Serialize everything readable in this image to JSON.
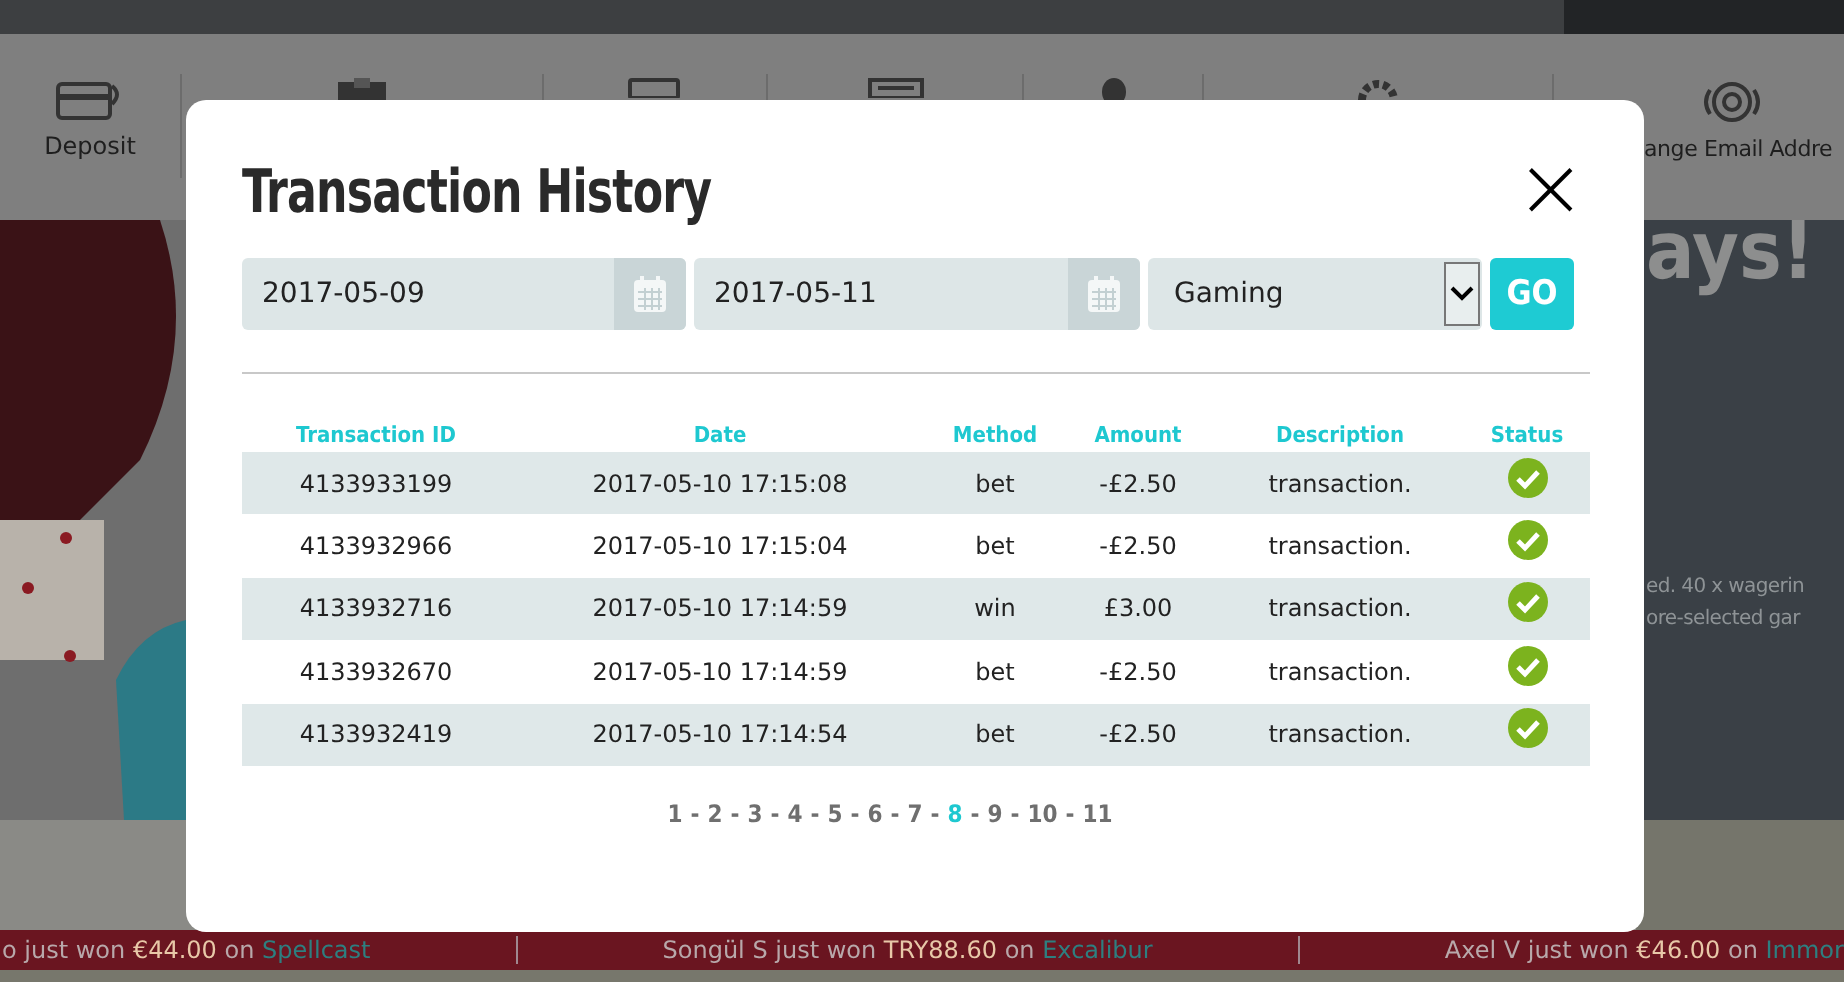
{
  "nav": {
    "first_label": "Deposit",
    "last_label": "ange Email Addre"
  },
  "banner": {
    "heading": "ays!",
    "lines": [
      "ed. 40 x wagerin",
      "ore-selected gar"
    ]
  },
  "dialog": {
    "title": "Transaction History",
    "close": "×",
    "filters": {
      "date_from": "2017-05-09",
      "date_to": "2017-05-11",
      "category": "Gaming",
      "go": "GO"
    },
    "table": {
      "columns": [
        "Transaction ID",
        "Date",
        "Method",
        "Amount",
        "Description",
        "Status"
      ],
      "rows": [
        {
          "id": "4133933199",
          "date": "2017-05-10 17:15:08",
          "method": "bet",
          "amount": "-£2.50",
          "description": "transaction.",
          "succeeded": true
        },
        {
          "id": "4133932966",
          "date": "2017-05-10 17:15:04",
          "method": "bet",
          "amount": "-£2.50",
          "description": "transaction.",
          "succeeded": true
        },
        {
          "id": "4133932716",
          "date": "2017-05-10 17:14:59",
          "method": "win",
          "amount": "£3.00",
          "description": "transaction.",
          "succeeded": true
        },
        {
          "id": "4133932670",
          "date": "2017-05-10 17:14:59",
          "method": "bet",
          "amount": "-£2.50",
          "description": "transaction.",
          "succeeded": true
        },
        {
          "id": "4133932419",
          "date": "2017-05-10 17:14:54",
          "method": "bet",
          "amount": "-£2.50",
          "description": "transaction.",
          "succeeded": true
        }
      ]
    },
    "pagination": {
      "separator": "-",
      "pages": [
        {
          "label": "1",
          "selected": false
        },
        {
          "label": "2",
          "selected": false
        },
        {
          "label": "3",
          "selected": false
        },
        {
          "label": "4",
          "selected": false
        },
        {
          "label": "5",
          "selected": false
        },
        {
          "label": "6",
          "selected": false
        },
        {
          "label": "7",
          "selected": false
        },
        {
          "label": "8",
          "selected": true
        },
        {
          "label": "9",
          "selected": false
        },
        {
          "label": "10",
          "selected": false
        },
        {
          "label": "11",
          "selected": false
        }
      ]
    }
  },
  "ticker": [
    {
      "player": "o just won",
      "amount": "€44.00",
      "on": "on",
      "game": "Spellcast"
    },
    {
      "player": "Songül S just won",
      "amount": "TRY88.60",
      "on": "on",
      "game": "Excalibur"
    },
    {
      "player": "Axel V just won",
      "amount": "€46.00",
      "on": "on",
      "game": "Immor"
    }
  ]
}
